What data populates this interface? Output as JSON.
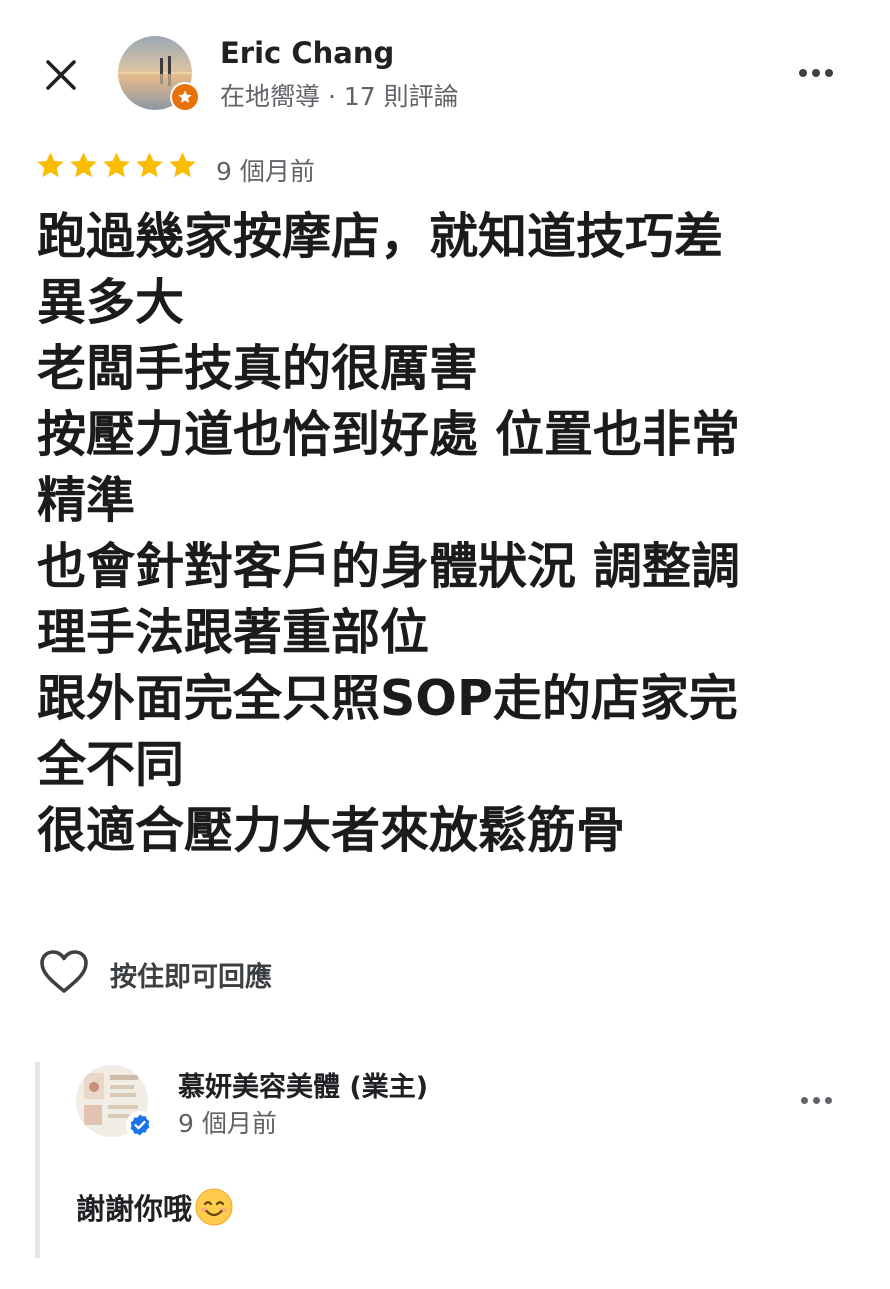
{
  "header": {
    "reviewer_name": "Eric Chang",
    "reviewer_meta": "在地嚮導 · 17 則評論",
    "close_icon": "close-icon",
    "more_icon": "more-horiz-icon",
    "guide_badge_color": "#e8710a"
  },
  "review": {
    "rating": 5,
    "rating_max": 5,
    "star_color": "#fbbc04",
    "date": "9 個月前",
    "lines": [
      "跑過幾家按摩店，就知道技巧差",
      "異多大",
      "老闆手技真的很厲害",
      "按壓力道也恰到好處 位置也非常",
      "精準",
      "也會針對客戶的身體狀況 調整調",
      "理手法跟著重部位",
      "跟外面完全只照SOP走的店家完",
      "全不同",
      "很適合壓力大者來放鬆筋骨"
    ]
  },
  "actions": {
    "like_icon": "heart-outline-icon",
    "like_label": "按住即可回應"
  },
  "owner_reply": {
    "name": "慕妍美容美體 (業主)",
    "date": "9 個月前",
    "text": "謝謝你哦",
    "emoji_icon": "smiling-face-icon",
    "verified_color": "#1a73e8"
  }
}
